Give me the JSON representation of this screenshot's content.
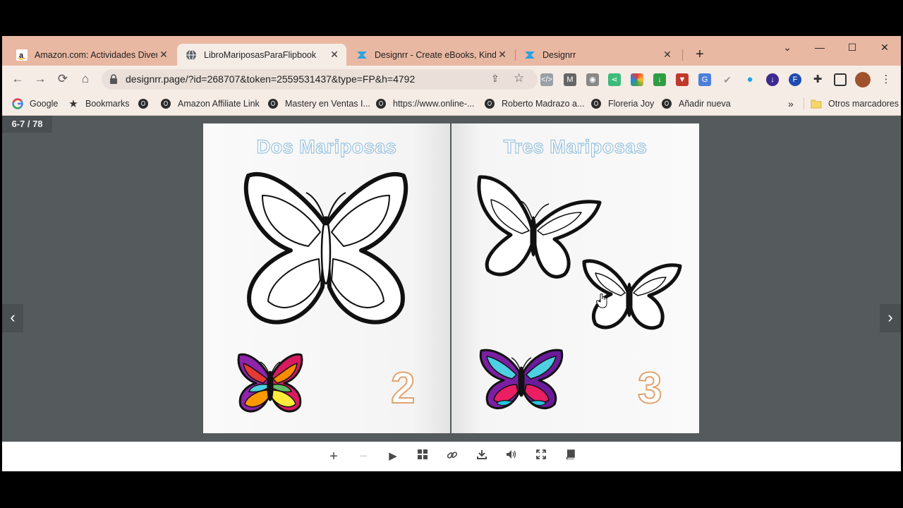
{
  "tabs": [
    {
      "title": "Amazon.com: Actividades Divertid",
      "favicon": "amazon-icon",
      "active": false
    },
    {
      "title": "LibroMariposasParaFlipbook",
      "favicon": "globe-icon",
      "active": true
    },
    {
      "title": "Designrr - Create eBooks, Kindle",
      "favicon": "designrr-icon",
      "active": false
    },
    {
      "title": "Designrr",
      "favicon": "designrr-icon",
      "active": false
    }
  ],
  "url": "designrr.page/?id=268707&token=2559531437&type=FP&h=4792",
  "bookmarks": [
    {
      "label": "Google",
      "icon": "google-icon"
    },
    {
      "label": "Bookmarks",
      "icon": "star-icon"
    },
    {
      "label": "",
      "icon": "globe-icon"
    },
    {
      "label": "Amazon Affiliate Link",
      "icon": "globe-icon"
    },
    {
      "label": "Mastery en Ventas I...",
      "icon": "globe-icon"
    },
    {
      "label": "https://www.online-...",
      "icon": "globe-icon"
    },
    {
      "label": "Roberto Madrazo a...",
      "icon": "globe-icon"
    },
    {
      "label": "Floreria Joy",
      "icon": "globe-icon"
    },
    {
      "label": "Añadir nueva",
      "icon": "globe-icon"
    }
  ],
  "bookmarks_overflow": "»",
  "other_bookmarks": "Otros marcadores",
  "viewer": {
    "page_counter": "6-7 / 78",
    "left_page": {
      "title": "Dos Mariposas",
      "number": "2"
    },
    "right_page": {
      "title": "Tres Mariposas",
      "number": "3"
    }
  },
  "colors": {
    "tab_strip": "#e9b8a2",
    "toolbar": "#f6ece6",
    "viewer_bg": "#555b5d",
    "title_outline": "#9cc3dd",
    "number_outline": "#e0a36f"
  }
}
